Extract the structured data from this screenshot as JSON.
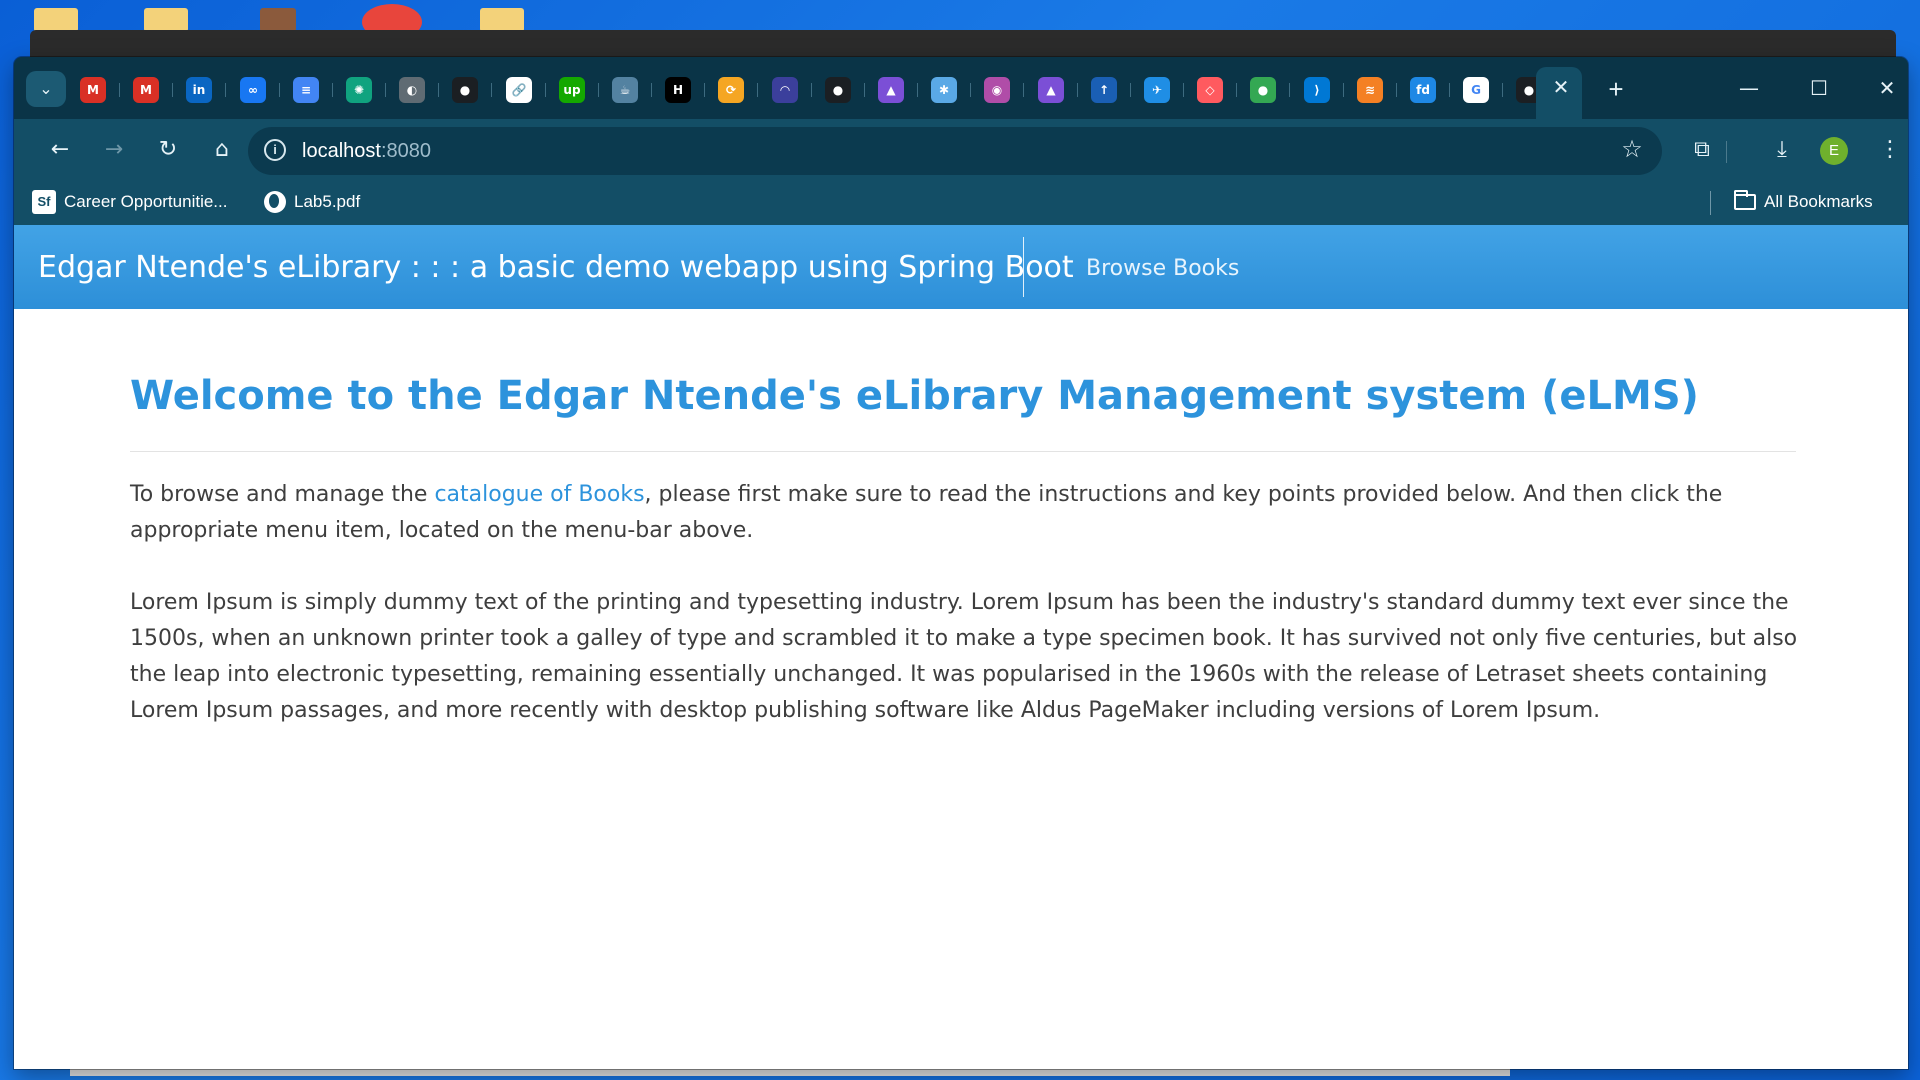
{
  "colors": {
    "browser_frame": "#0b3c52",
    "tab_strip": "#0a3447",
    "toolbar": "#134e66",
    "app_navbar": "#42a3e6",
    "heading": "#2d93dc",
    "link": "#2d93dc",
    "body_text": "#3e3e3e",
    "avatar": "#6fb02d"
  },
  "tabs": {
    "pinned": [
      {
        "icon": "gmail-icon",
        "glyph": "M",
        "color": "#d93025"
      },
      {
        "icon": "gmail-icon",
        "glyph": "M",
        "color": "#d93025"
      },
      {
        "icon": "linkedin-icon",
        "glyph": "in",
        "color": "#0a66c2"
      },
      {
        "icon": "meta-icon",
        "glyph": "∞",
        "color": "#1877f2"
      },
      {
        "icon": "google-docs-icon",
        "glyph": "≡",
        "color": "#4285f4"
      },
      {
        "icon": "chatgpt-icon",
        "glyph": "✺",
        "color": "#10a37f"
      },
      {
        "icon": "globe-icon",
        "glyph": "◐",
        "color": "#5f6b73"
      },
      {
        "icon": "github-icon",
        "glyph": "●",
        "color": "#1b1f23"
      },
      {
        "icon": "link-icon",
        "glyph": "🔗",
        "color": "#ffffff"
      },
      {
        "icon": "upwork-icon",
        "glyph": "up",
        "color": "#14a800"
      },
      {
        "icon": "java-icon",
        "glyph": "☕",
        "color": "#5382a1"
      },
      {
        "icon": "hackerrank-icon",
        "glyph": "H",
        "color": "#000000"
      },
      {
        "icon": "sourcegraph-icon",
        "glyph": "⟳",
        "color": "#f5a623"
      },
      {
        "icon": "speedometer-icon",
        "glyph": "◠",
        "color": "#3b3f9c"
      },
      {
        "icon": "github-icon",
        "glyph": "●",
        "color": "#1b1f23"
      },
      {
        "icon": "rocket-icon",
        "glyph": "▲",
        "color": "#7b4fd6"
      },
      {
        "icon": "lightbulb-icon",
        "glyph": "✱",
        "color": "#5aa9e6"
      },
      {
        "icon": "podcast-icon",
        "glyph": "◉",
        "color": "#b04da8"
      },
      {
        "icon": "rocket-icon",
        "glyph": "▲",
        "color": "#7b4fd6"
      },
      {
        "icon": "upload-icon",
        "glyph": "↑",
        "color": "#1a5fb4"
      },
      {
        "icon": "airplane-icon",
        "glyph": "✈",
        "color": "#1f8ee5"
      },
      {
        "icon": "airbnb-icon",
        "glyph": "◇",
        "color": "#ff5a5f"
      },
      {
        "icon": "google-maps-icon",
        "glyph": "●",
        "color": "#34a853"
      },
      {
        "icon": "vscode-icon",
        "glyph": "⟩",
        "color": "#0078d4"
      },
      {
        "icon": "stackoverflow-icon",
        "glyph": "≋",
        "color": "#f48024"
      },
      {
        "icon": "freedocs-icon",
        "glyph": "fd",
        "color": "#1e88e5"
      },
      {
        "icon": "google-icon",
        "glyph": "G",
        "color": "#ffffff"
      },
      {
        "icon": "github-icon",
        "glyph": "●",
        "color": "#1b1f23"
      }
    ],
    "active_close_glyph": "✕",
    "new_tab_glyph": "+"
  },
  "window_controls": {
    "minimize": "—",
    "maximize": "☐",
    "close": "✕"
  },
  "toolbar": {
    "back": "←",
    "forward": "→",
    "reload": "↻",
    "home": "⌂",
    "site_info": "i",
    "url_host": "localhost",
    "url_port": ":8080",
    "bookmark_star": "☆",
    "extensions": "⧉",
    "download": "⤓",
    "profile_initial": "E",
    "menu": "⋮"
  },
  "bookmarks": {
    "items": [
      {
        "label": "Career Opportunitie...",
        "icon": "sfi-icon",
        "glyph": "Sf"
      },
      {
        "label": "Lab5.pdf",
        "icon": "globe-icon"
      }
    ],
    "all_bookmarks": "All Bookmarks"
  },
  "app": {
    "brand": "Edgar Ntende's eLibrary : : : a basic demo webapp using Spring Boot",
    "nav_browse": "Browse Books",
    "heading": "Welcome to the Edgar Ntende's eLibrary Management system (eLMS)",
    "intro_before_link": "To browse and manage the ",
    "intro_link": "catalogue of Books",
    "intro_after_link": ", please first make sure to read the instructions and key points provided below. And then click the appropriate menu item, located on the menu-bar above.",
    "lorem": "Lorem Ipsum is simply dummy text of the printing and typesetting industry. Lorem Ipsum has been the industry's standard dummy text ever since the 1500s, when an unknown printer took a galley of type and scrambled it to make a type specimen book. It has survived not only five centuries, but also the leap into electronic typesetting, remaining essentially unchanged. It was popularised in the 1960s with the release of Letraset sheets containing Lorem Ipsum passages, and more recently with desktop publishing software like Aldus PageMaker including versions of Lorem Ipsum."
  }
}
